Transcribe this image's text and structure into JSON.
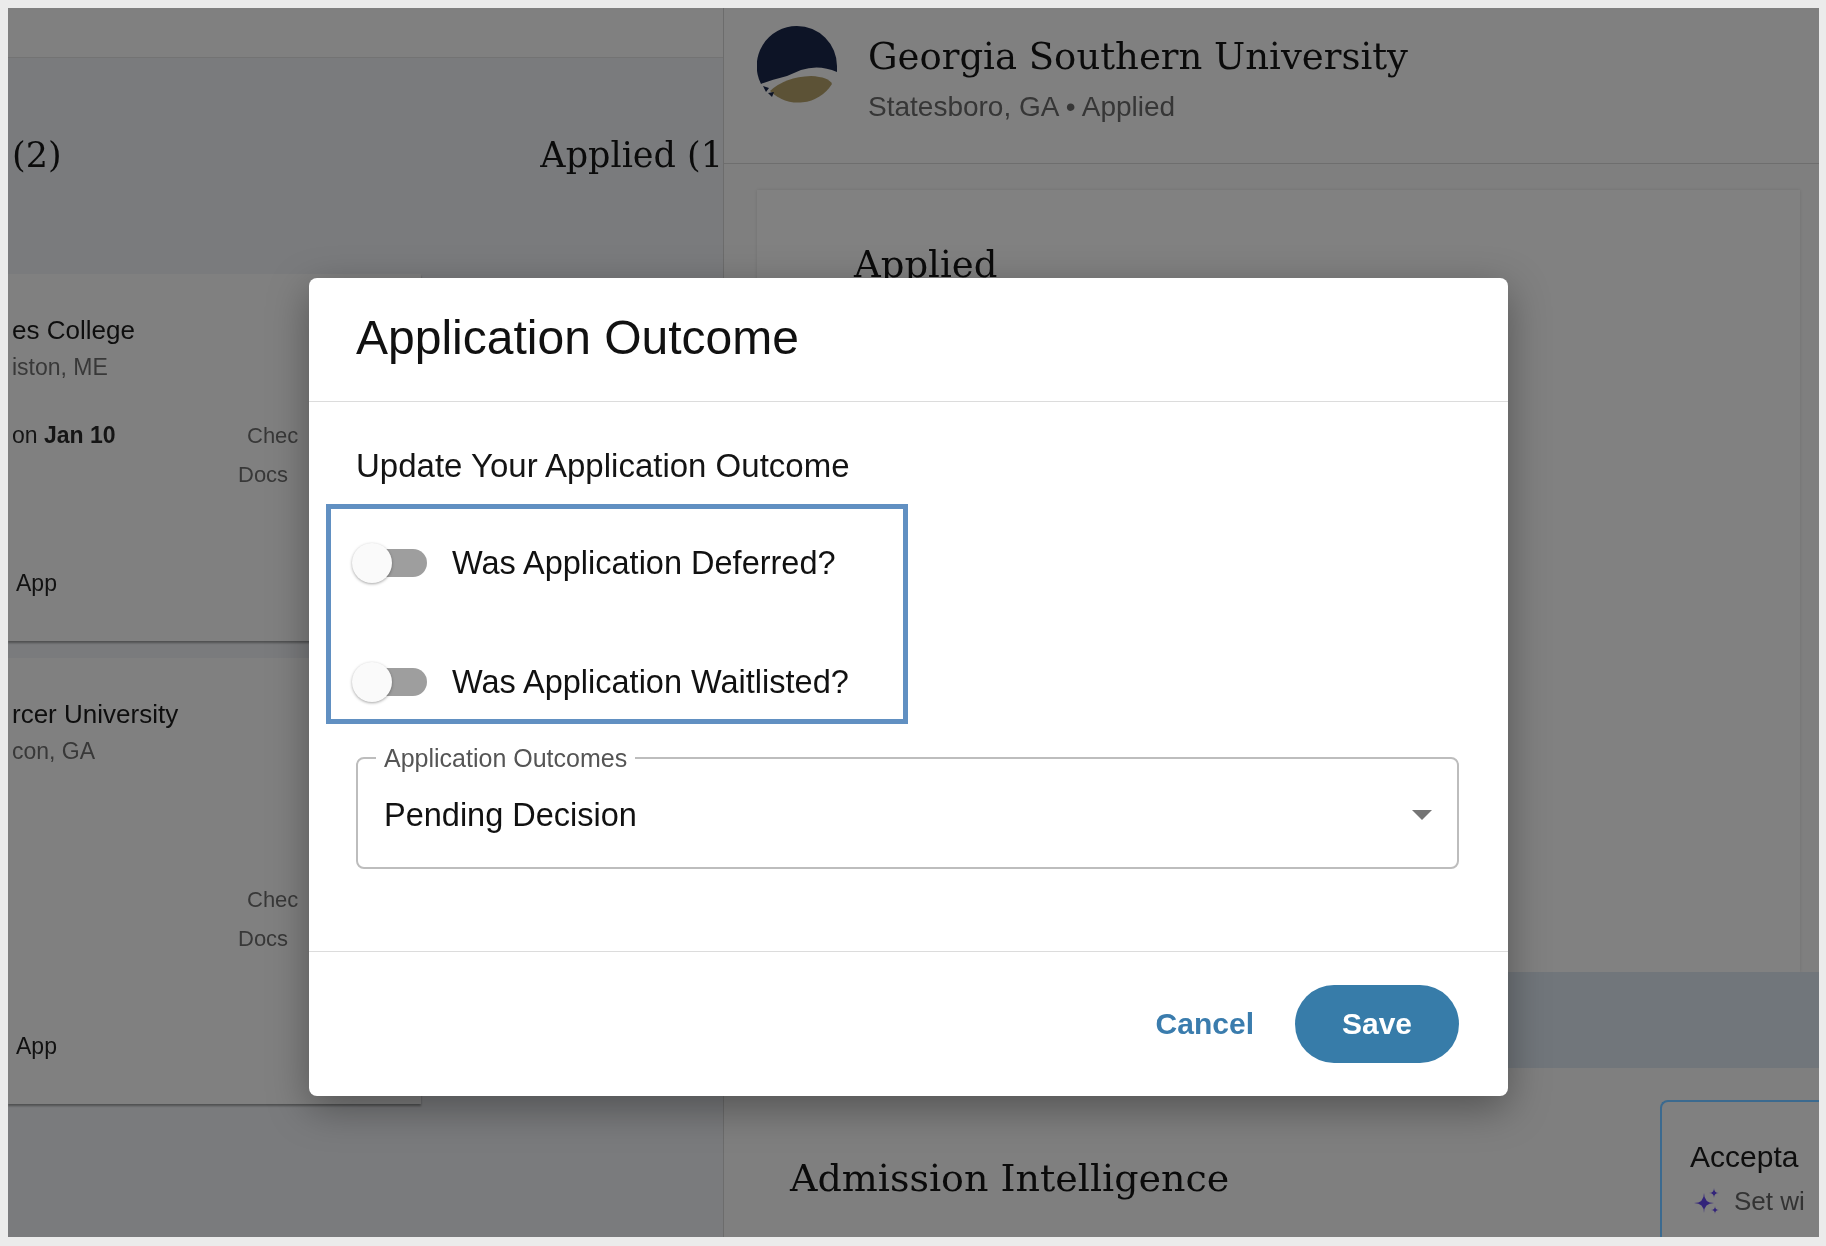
{
  "board": {
    "columns": [
      {
        "title": "(2)"
      },
      {
        "title": "Applied (1"
      }
    ],
    "cards": [
      {
        "name": "es College",
        "location": "iston, ME",
        "deadline": "on **Jan 10**",
        "checklist": [
          "Chec",
          "Docs"
        ],
        "action": "App"
      },
      {
        "name": "rcer University",
        "location": "con, GA",
        "checklist": [
          "Chec",
          "Docs"
        ],
        "action": "App"
      }
    ]
  },
  "school": {
    "name": "Georgia Southern University",
    "subtitle": "Statesboro, GA • Applied",
    "status_heading": "Applied",
    "section_heading": "Admission Intelligence",
    "insight_card": {
      "title": "Accepta",
      "note": "Set wi"
    }
  },
  "dialog": {
    "title": "Application Outcome",
    "prompt": "Update Your Application Outcome",
    "toggles": [
      {
        "label": "Was Application Deferred?",
        "on": false
      },
      {
        "label": "Was Application Waitlisted?",
        "on": false
      }
    ],
    "outcome_select": {
      "label": "Application Outcomes",
      "value": "Pending Decision"
    },
    "buttons": [
      {
        "label": "Cancel",
        "kind": "text"
      },
      {
        "label": "Save",
        "kind": "primary"
      }
    ]
  }
}
